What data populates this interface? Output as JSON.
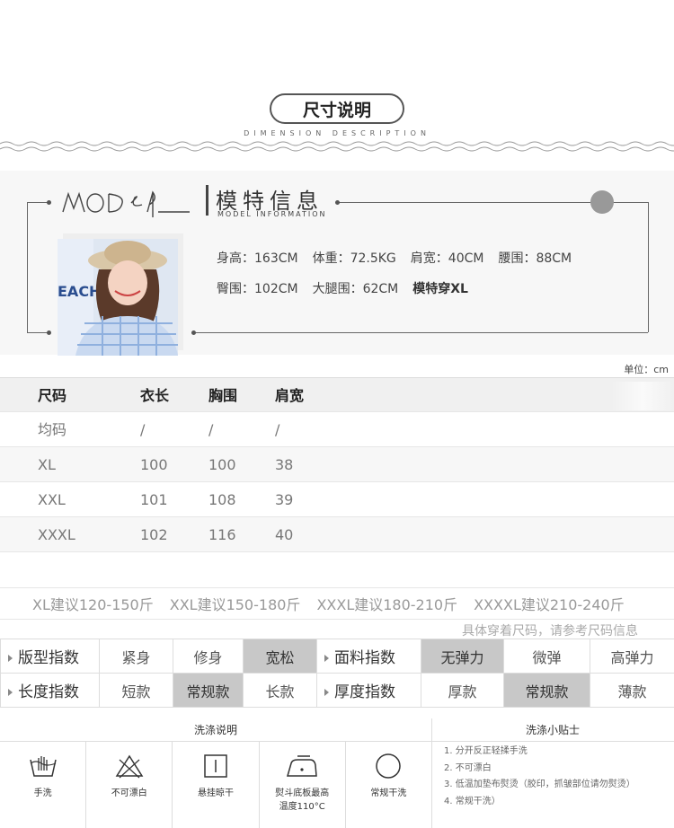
{
  "header": {
    "title": "尺寸说明",
    "subtitle": "DIMENSION DESCRIPTION"
  },
  "model": {
    "script_text": "MODEL",
    "title": "模特信息",
    "subtitle": "MODEL INFORMATION",
    "photo_text": "EACH",
    "row1": [
      "身高：163CM",
      "体重：72.5KG",
      "肩宽：40CM",
      "腰围：88CM"
    ],
    "row2": [
      "臀围：102CM",
      "大腿围：62CM"
    ],
    "row2_bold": "模特穿XL"
  },
  "unit": "单位：cm",
  "size_table": {
    "headers": [
      "尺码",
      "衣长",
      "胸围",
      "肩宽"
    ],
    "rows": [
      [
        "均码",
        "/",
        "/",
        "/"
      ],
      [
        "XL",
        "100",
        "100",
        "38"
      ],
      [
        "XXL",
        "101",
        "108",
        "39"
      ],
      [
        "XXXL",
        "102",
        "116",
        "40"
      ]
    ]
  },
  "suggestions": [
    "XL建议120-150斤",
    "XXL建议150-180斤",
    "XXXL建议180-210斤",
    "XXXXL建议210-240斤"
  ],
  "refer_note": "具体穿着尺码，请参考尺码信息",
  "index": {
    "row1": {
      "label": "版型指数",
      "options": [
        "紧身",
        "修身",
        "宽松"
      ],
      "selected": 2,
      "label2": "面料指数",
      "options2": [
        "无弹力",
        "微弹",
        "高弹力"
      ],
      "selected2": 0
    },
    "row2": {
      "label": "长度指数",
      "options": [
        "短款",
        "常规款",
        "长款"
      ],
      "selected": 1,
      "label2": "厚度指数",
      "options2": [
        "厚款",
        "常规款",
        "薄款"
      ],
      "selected2": 1
    }
  },
  "wash": {
    "heading": "洗涤说明",
    "tips_heading": "洗涤小贴士",
    "icons": [
      {
        "icon": "hand-wash-icon",
        "label": "手洗"
      },
      {
        "icon": "no-bleach-icon",
        "label": "不可漂白"
      },
      {
        "icon": "hang-dry-icon",
        "label": "悬挂晾干"
      },
      {
        "icon": "iron-icon",
        "label": "熨斗底板最高",
        "label2": "温度110°C"
      },
      {
        "icon": "dry-clean-icon",
        "label": "常规干洗"
      }
    ],
    "tips": [
      "1. 分开反正轻揉手洗",
      "2. 不可漂白",
      "3. 低温加垫布熨烫（胶印，抓皱部位请勿熨烫）",
      "4. 常规干洗）"
    ]
  }
}
